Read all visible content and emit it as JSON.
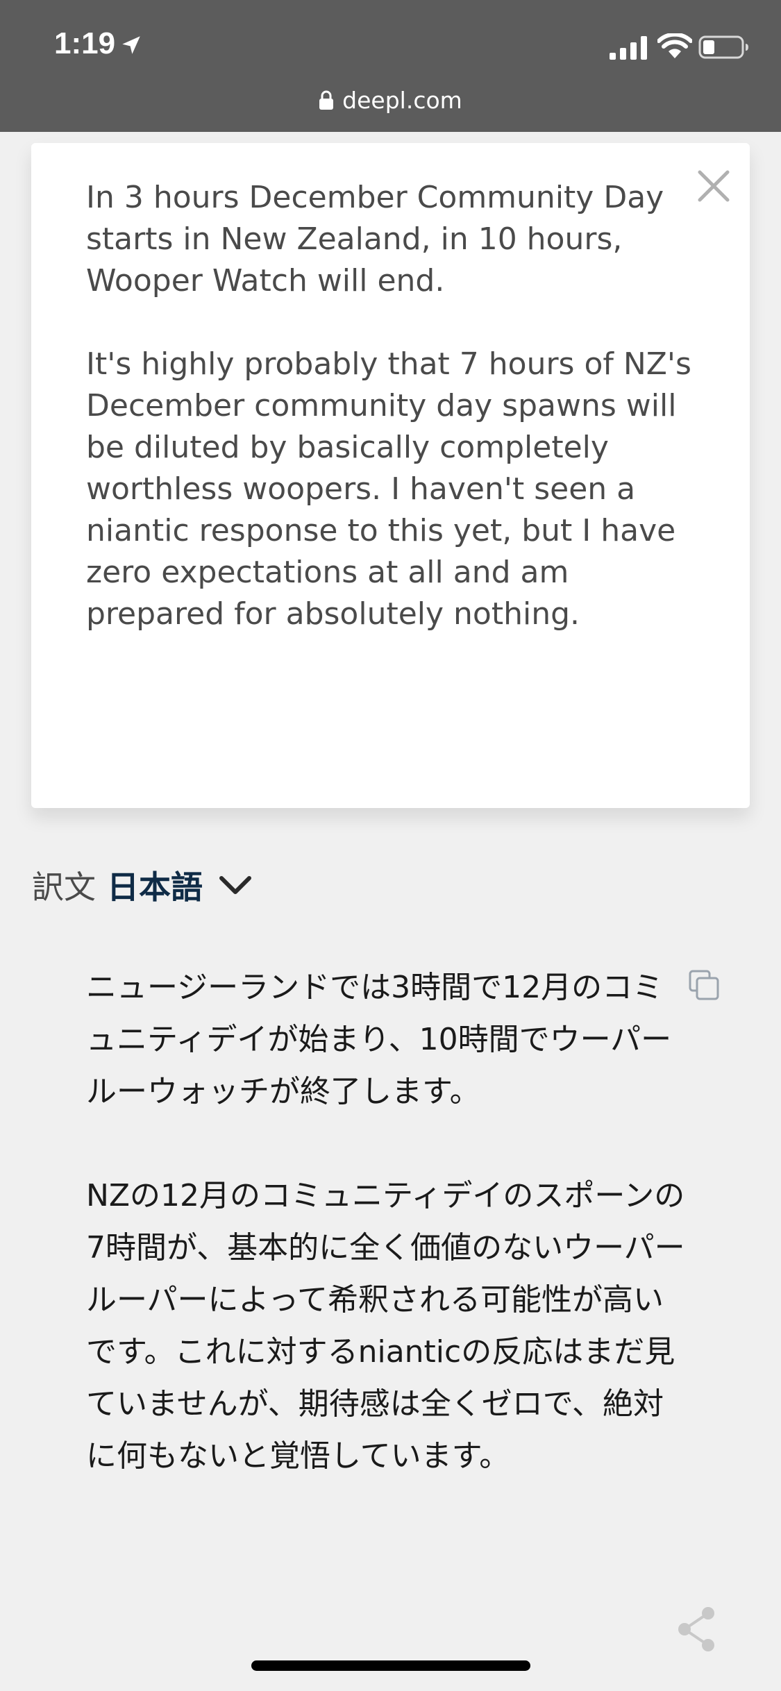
{
  "status_bar": {
    "time": "1:19",
    "url": "deepl.com"
  },
  "source": {
    "paragraphs": [
      "In 3 hours December Community Day starts in New Zealand, in 10 hours, Wooper Watch will end.",
      "It's highly probably that 7 hours of NZ's December community day spawns will be diluted by basically completely worthless woopers. I haven't seen a niantic response to this yet, but I have zero expectations at all and am prepared for absolutely nothing."
    ]
  },
  "target": {
    "label_prefix": "訳文",
    "language": "日本語",
    "paragraphs": [
      "ニュージーランドでは3時間で12月のコミュニティデイが始まり、10時間でウーパールーウォッチが終了します。",
      "NZの12月のコミュニティデイのスポーンの7時間が、基本的に全く価値のないウーパールーパーによって希釈される可能性が高いです。これに対するnianticの反応はまだ見ていませんが、期待感は全くゼロで、絶対に何もないと覚悟しています。"
    ]
  },
  "icons": {
    "location": "location-arrow",
    "signal": "cellular-signal",
    "wifi": "wifi",
    "battery": "battery-low",
    "lock": "lock",
    "close": "close-x",
    "chevron": "chevron-down",
    "copy": "copy",
    "share": "share"
  }
}
